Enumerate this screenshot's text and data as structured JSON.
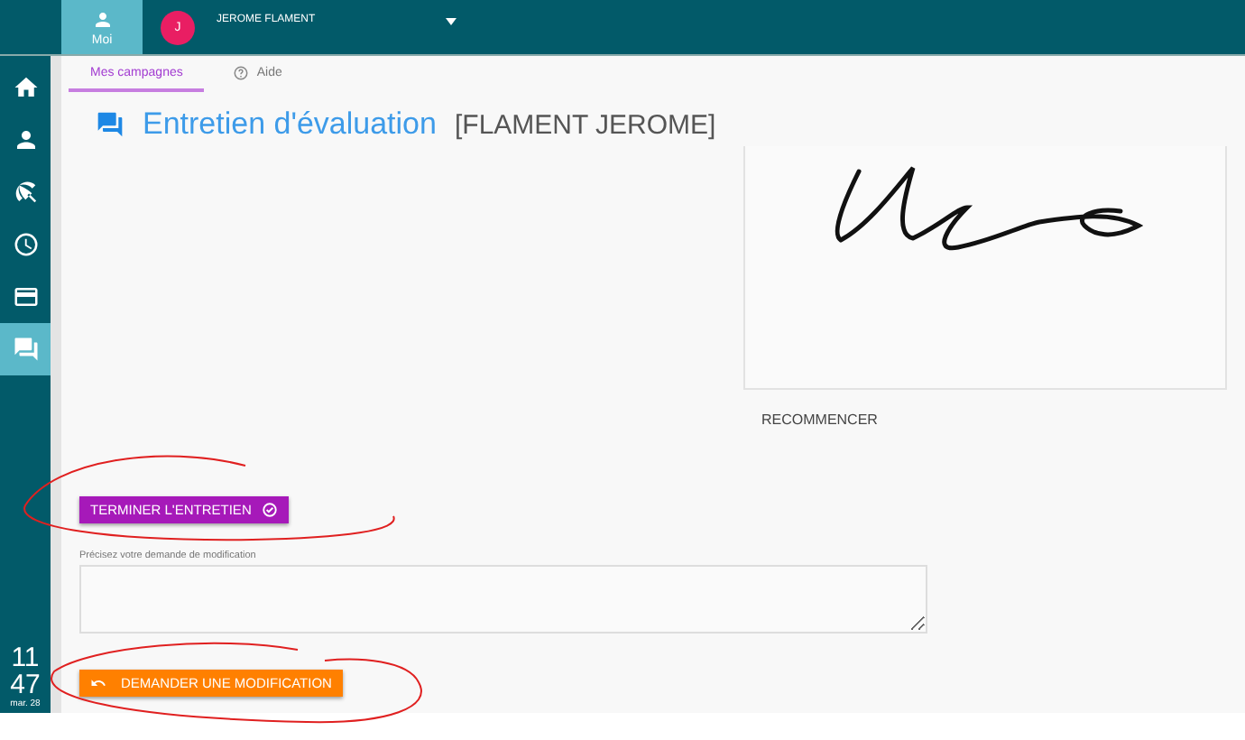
{
  "top_bar": {
    "profile_tab": {
      "label": "Moi",
      "selected": true
    },
    "user": {
      "initial": "J",
      "name": "JEROME FLAMENT"
    }
  },
  "sidebar": {
    "items": [
      {
        "selected": false
      },
      {
        "selected": false
      },
      {
        "selected": false
      },
      {
        "selected": false
      },
      {
        "selected": false
      },
      {
        "selected": true
      }
    ],
    "clock": {
      "hour": "11",
      "minute": "47",
      "date": "mar. 28"
    }
  },
  "tabs": [
    {
      "label": "Mes campagnes",
      "selected": true,
      "kind": "plain"
    },
    {
      "label": "Aide",
      "selected": false,
      "kind": "help"
    }
  ],
  "header": {
    "title": "Entretien d'évaluation",
    "subject": "[FLAMENT JEROME]"
  },
  "signature": {
    "reset_label": "RECOMMENCER"
  },
  "finish_button": {
    "label": "TERMINER L'ENTRETIEN"
  },
  "modification_field": {
    "label": "Précisez votre demande de modification"
  },
  "request_button": {
    "label": "DEMANDER UNE MODIFICATION"
  }
}
